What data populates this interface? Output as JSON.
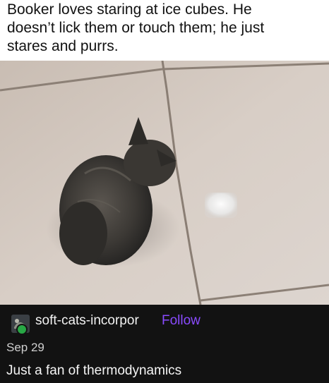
{
  "caption": {
    "line1": "Booker loves staring at ice cubes. He",
    "line2": "doesn’t lick them or touch them; he just",
    "line3": "stares and purrs."
  },
  "photo": {
    "subject": "kitten-looking-at-ice-cube"
  },
  "post": {
    "username": "soft-cats-incorpor",
    "follow_label": "Follow",
    "date": "Sep 29",
    "text": "Just a fan of thermodynamics"
  },
  "colors": {
    "footer_bg": "#121212",
    "follow": "#8a4bff",
    "avatar_badge": "#28a745"
  }
}
